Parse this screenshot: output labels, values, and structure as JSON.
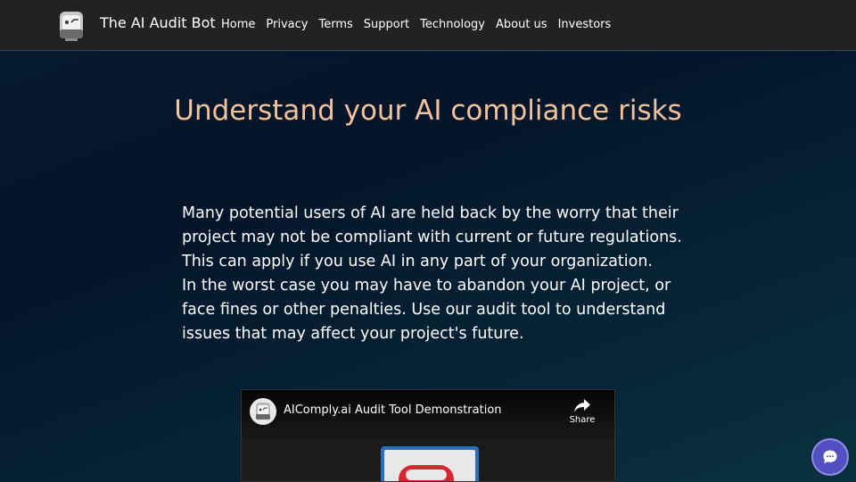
{
  "header": {
    "brand": "The AI Audit Bot",
    "nav": [
      "Home",
      "Privacy",
      "Terms",
      "Support",
      "Technology",
      "About us",
      "Investors"
    ]
  },
  "hero": {
    "title": "Understand your AI compliance risks",
    "paragraphs": [
      "Many potential users of AI are held back by the worry that their",
      "project may not be compliant with current or future regulations.",
      "This can apply if you use AI in any part of your organization.",
      "In the worst case you may have to abandon your AI project, or",
      "face fines or other penalties. Use our audit tool to understand",
      "issues that may affect your project's future."
    ]
  },
  "video": {
    "title": "AIComply.ai Audit Tool Demonstration",
    "share_label": "Share"
  },
  "icons": {
    "logo": "robot-face-icon",
    "share": "share-arrow-icon",
    "chat": "chat-bubble-icon"
  },
  "colors": {
    "header_bg": "#222222",
    "title": "#f4c39a",
    "text": "#ffffff",
    "chat_button": "#5450c4"
  }
}
